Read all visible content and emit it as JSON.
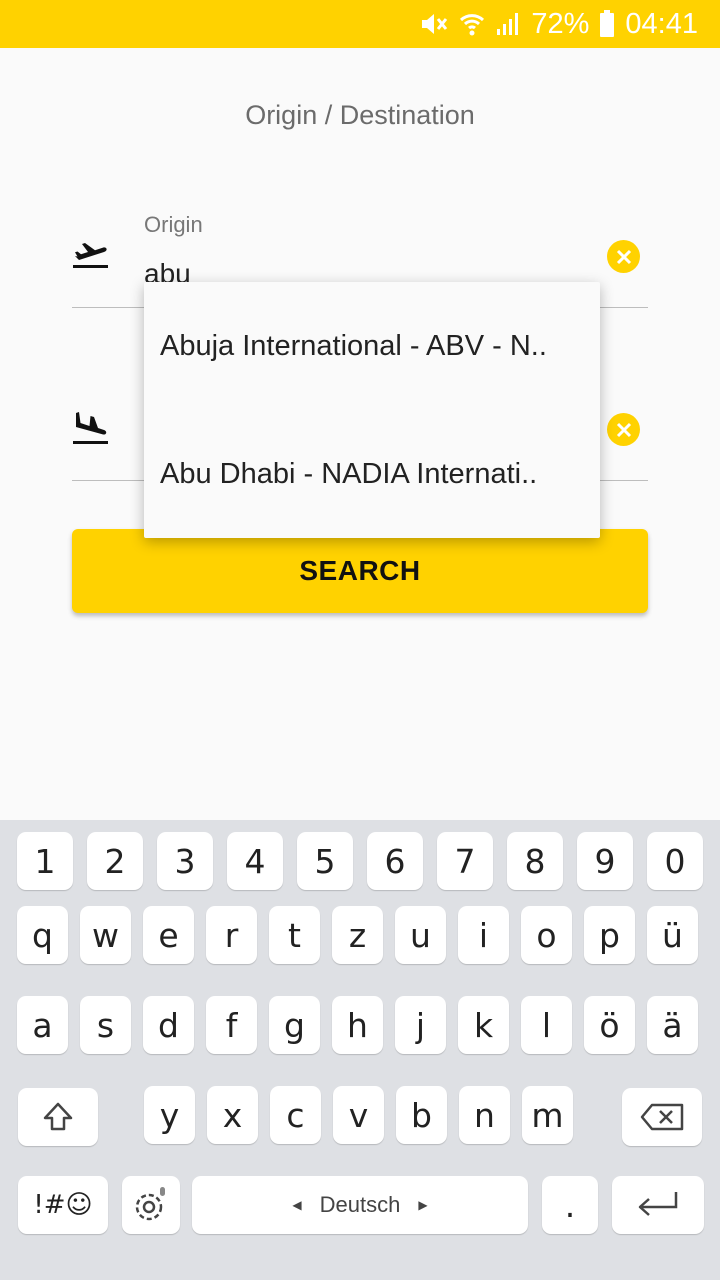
{
  "status_bar": {
    "battery": "72%",
    "time": "04:41",
    "icons": [
      "mute-icon",
      "wifi-icon",
      "signal-icon",
      "battery-icon"
    ]
  },
  "page": {
    "title": "Origin / Destination"
  },
  "form": {
    "origin_label": "Origin",
    "origin_value": "abu",
    "destination_value": ""
  },
  "suggestions": [
    "Abuja International - ABV - N..",
    "Abu Dhabi - NADIA Internati.."
  ],
  "search_button": "SEARCH",
  "keyboard": {
    "row1": [
      "1",
      "2",
      "3",
      "4",
      "5",
      "6",
      "7",
      "8",
      "9",
      "0"
    ],
    "row2": [
      "q",
      "w",
      "e",
      "r",
      "t",
      "z",
      "u",
      "i",
      "o",
      "p",
      "ü"
    ],
    "row3": [
      "a",
      "s",
      "d",
      "f",
      "g",
      "h",
      "j",
      "k",
      "l",
      "ö",
      "ä"
    ],
    "row4": [
      "y",
      "x",
      "c",
      "v",
      "b",
      "n",
      "m"
    ],
    "symbols_label": "!#☺",
    "space_label": "Deutsch",
    "period": "."
  },
  "colors": {
    "accent": "#ffd200",
    "background": "#fafafa",
    "keyboard_bg": "#dee0e4"
  }
}
